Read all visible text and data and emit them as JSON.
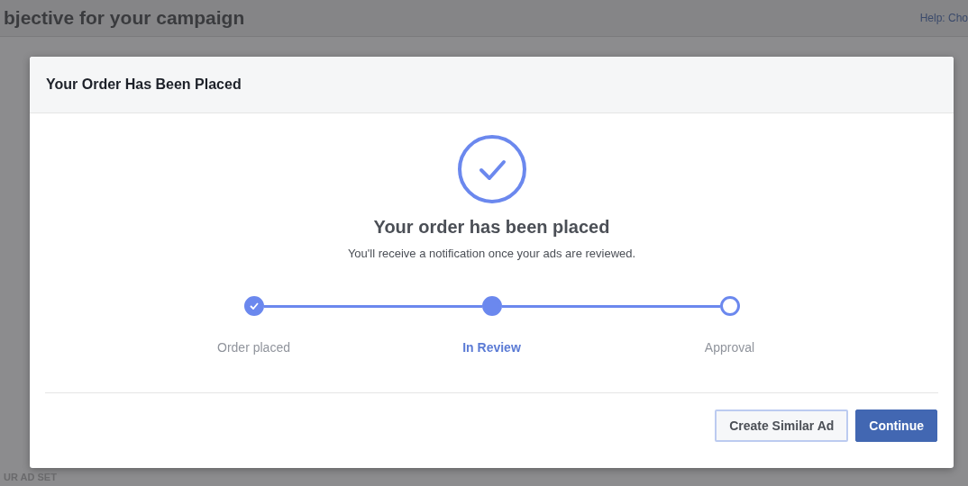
{
  "page": {
    "title": "bjective for your campaign",
    "help_link": "Help: Cho",
    "section_label": "UR AD SET"
  },
  "modal": {
    "title": "Your Order Has Been Placed",
    "heading": "Your order has been placed",
    "message": "You'll receive a notification once your ads are reviewed.",
    "steps": [
      {
        "label": "Order placed",
        "kind": "done",
        "selected": false
      },
      {
        "label": "In Review",
        "kind": "current",
        "selected": true
      },
      {
        "label": "Approval",
        "kind": "pending",
        "selected": false
      }
    ],
    "buttons": [
      {
        "label": "Create Similar Ad",
        "kind": "secondary"
      },
      {
        "label": "Continue",
        "kind": "primary"
      }
    ]
  }
}
